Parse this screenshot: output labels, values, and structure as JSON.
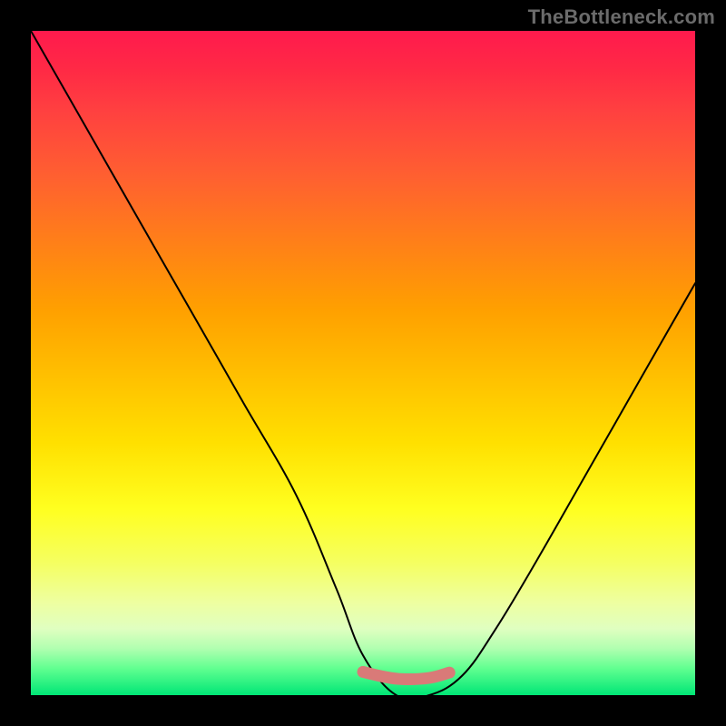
{
  "watermark": "TheBottleneck.com",
  "chart_data": {
    "type": "line",
    "title": "",
    "xlabel": "",
    "ylabel": "",
    "xlim": [
      0,
      100
    ],
    "ylim": [
      0,
      100
    ],
    "series": [
      {
        "name": "bottleneck-curve",
        "x": [
          0,
          8,
          16,
          24,
          32,
          40,
          46,
          50,
          55,
          60,
          65,
          70,
          76,
          84,
          92,
          100
        ],
        "values": [
          100,
          86,
          72,
          58,
          44,
          30,
          16,
          6,
          0,
          0,
          3,
          10,
          20,
          34,
          48,
          62
        ]
      },
      {
        "name": "optimal-zone",
        "x": [
          50,
          53,
          56,
          60,
          63
        ],
        "values": [
          3.5,
          2.8,
          2.4,
          2.6,
          3.4
        ]
      }
    ],
    "colors": {
      "curve": "#000000",
      "optimal": "#d97a78"
    }
  }
}
